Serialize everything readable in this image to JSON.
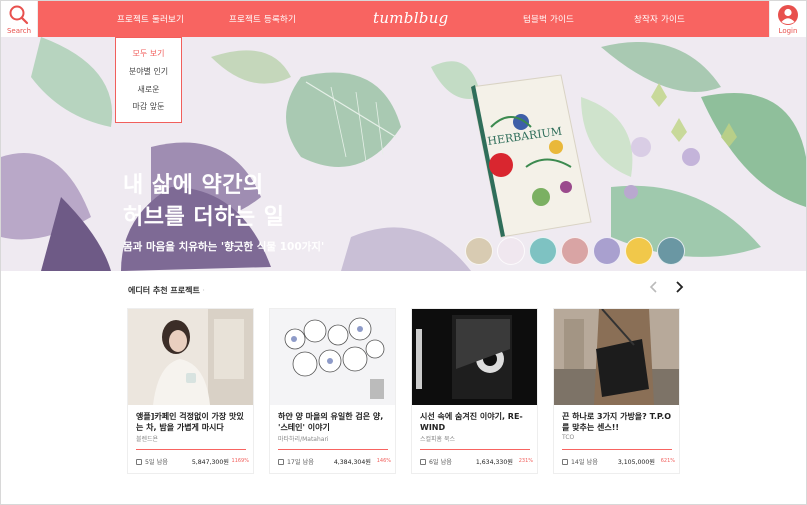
{
  "header": {
    "search_label": "Search",
    "login_label": "Login",
    "logo": "tumblbug",
    "nav": [
      {
        "label": "프로젝트 둘러보기"
      },
      {
        "label": "프로젝트 등록하기"
      },
      {
        "label": "텀블벅 가이드"
      },
      {
        "label": "창작자 가이드"
      }
    ],
    "accent_color": "#f86461"
  },
  "dropdown": {
    "items": [
      {
        "label": "모두 보기",
        "active": true
      },
      {
        "label": "분야별 인기",
        "active": false
      },
      {
        "label": "새로운",
        "active": false
      },
      {
        "label": "마감 앞둔",
        "active": false
      }
    ]
  },
  "hero": {
    "title_line1": "내 삶에 약간의",
    "title_line2": "허브를 더하는 일",
    "subtitle": "몸과 마음을 치유하는 '향긋한 식물 100가지'",
    "book_title": "HERBARIUM",
    "thumbnail_count": 7
  },
  "section": {
    "title": "에디터 추천 프로젝트",
    "prev_icon": "chevron-left-icon",
    "next_icon": "chevron-right-icon"
  },
  "cards": [
    {
      "title": "앵플]카페인 걱정없이 가장 맛있는 차, 밤을 가볍게 마시다",
      "author": "블렌드욘",
      "days": "5일 남음",
      "amount": "5,847,300원",
      "percent": "1169%",
      "progress": 1.0
    },
    {
      "title": "하얀 양 마을의 유일한 검은 양, '스테인' 이야기",
      "author": "마타하리/Matahari",
      "days": "17일 남음",
      "amount": "4,384,304원",
      "percent": "146%",
      "progress": 1.0
    },
    {
      "title": "시선 속에 숨겨진 이야기, RE-WIND",
      "author": "스컬피흠 북스",
      "days": "6일 남음",
      "amount": "1,634,330원",
      "percent": "231%",
      "progress": 1.0
    },
    {
      "title": "끈 하나로 3가지 가방을? T.P.O를 맞추는 센스!!",
      "author": "TCO",
      "days": "14일 남음",
      "amount": "3,105,000원",
      "percent": "621%",
      "progress": 1.0
    }
  ]
}
